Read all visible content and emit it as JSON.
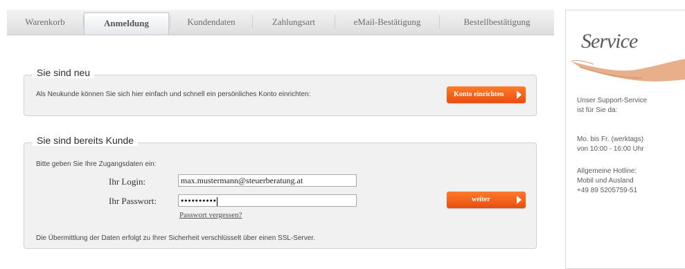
{
  "tabs": [
    {
      "label": "Warenkorb",
      "active": false
    },
    {
      "label": "Anmeldung",
      "active": true
    },
    {
      "label": "Kundendaten",
      "active": false
    },
    {
      "label": "Zahlungsart",
      "active": false
    },
    {
      "label": "eMail-Bestätigung",
      "active": false
    },
    {
      "label": "Bestellbestätigung",
      "active": false
    }
  ],
  "new_customer": {
    "legend": "Sie sind neu",
    "text": "Als Neukunde können Sie sich hier einfach und schnell ein persönliches Konto einrichten:",
    "button_label": "Konto einrichten"
  },
  "existing_customer": {
    "legend": "Sie sind bereits Kunde",
    "intro": "Bitte geben Sie Ihre Zugangsdaten ein:",
    "login_label": "Ihr Login:",
    "login_value": "max.mustermann@steuerberatung.at",
    "password_label": "Ihr Passwort:",
    "password_value": "••••••••••",
    "forgot_link": "Passwort vergessen?",
    "button_label": "weiter",
    "ssl_note": "Die Übermittlung der Daten erfolgt zu Ihrer Sicherheit verschlüsselt über einen SSL-Server."
  },
  "service": {
    "title": "Service",
    "support_line1": "Unser Support-Service",
    "support_line2": "ist für Sie da:",
    "hours_line1": "Mo. bis Fr. (werktags)",
    "hours_line2": "von 10:00 - 16:00 Uhr",
    "hotline_line1": "Allgemeine Hotline:",
    "hotline_line2": "Mobil und Ausland",
    "hotline_line3": "+49 89 5205759-51"
  },
  "colors": {
    "accent": "#ef5a16",
    "box_bg": "#f1f1f1"
  }
}
